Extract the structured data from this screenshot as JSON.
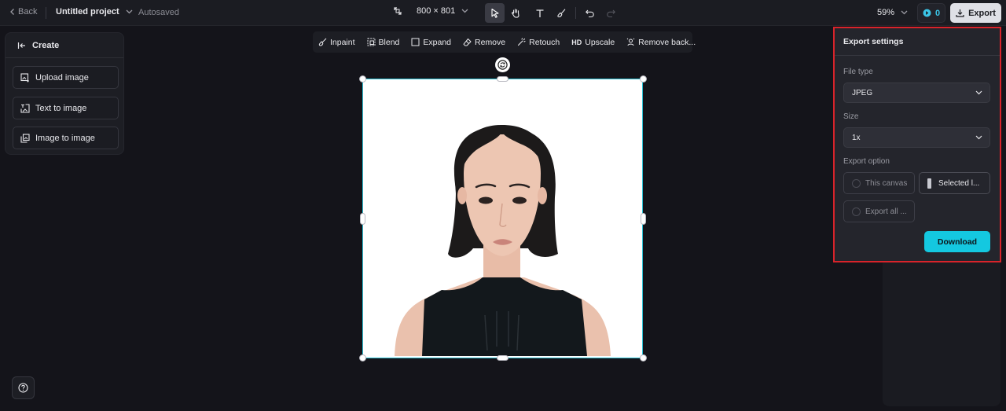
{
  "topbar": {
    "back_label": "Back",
    "project_name": "Untitled project",
    "autosave_status": "Autosaved",
    "canvas_dimensions": "800 × 801",
    "zoom_level": "59%",
    "credits": "0",
    "export_label": "Export"
  },
  "tools": [
    "select-tool",
    "hand-tool",
    "text-tool",
    "brush-tool",
    "undo",
    "redo"
  ],
  "left_panel": {
    "header": "Create",
    "buttons": [
      {
        "label": "Upload image",
        "icon": "upload-image-icon"
      },
      {
        "label": "Text to image",
        "icon": "text-to-image-icon"
      },
      {
        "label": "Image to image",
        "icon": "image-to-image-icon"
      }
    ]
  },
  "edit_toolbar": {
    "items": [
      {
        "label": "Inpaint",
        "icon": "inpaint-icon"
      },
      {
        "label": "Blend",
        "icon": "blend-icon"
      },
      {
        "label": "Expand",
        "icon": "expand-icon"
      },
      {
        "label": "Remove",
        "icon": "eraser-icon"
      },
      {
        "label": "Retouch",
        "icon": "retouch-icon"
      },
      {
        "label": "Upscale",
        "icon": "hd-icon",
        "icon_text": "HD"
      },
      {
        "label": "Remove back...",
        "icon": "remove-background-icon"
      }
    ]
  },
  "export_settings": {
    "title": "Export settings",
    "file_type_label": "File type",
    "file_type_value": "JPEG",
    "size_label": "Size",
    "size_value": "1x",
    "export_option_label": "Export option",
    "options": [
      "This canvas",
      "Selected l...",
      "Export all ..."
    ],
    "download_label": "Download"
  },
  "colors": {
    "accent": "#14c8e0",
    "selection_border": "#2fc3d6",
    "highlight_border": "#d8232a",
    "background": "#14141a"
  }
}
